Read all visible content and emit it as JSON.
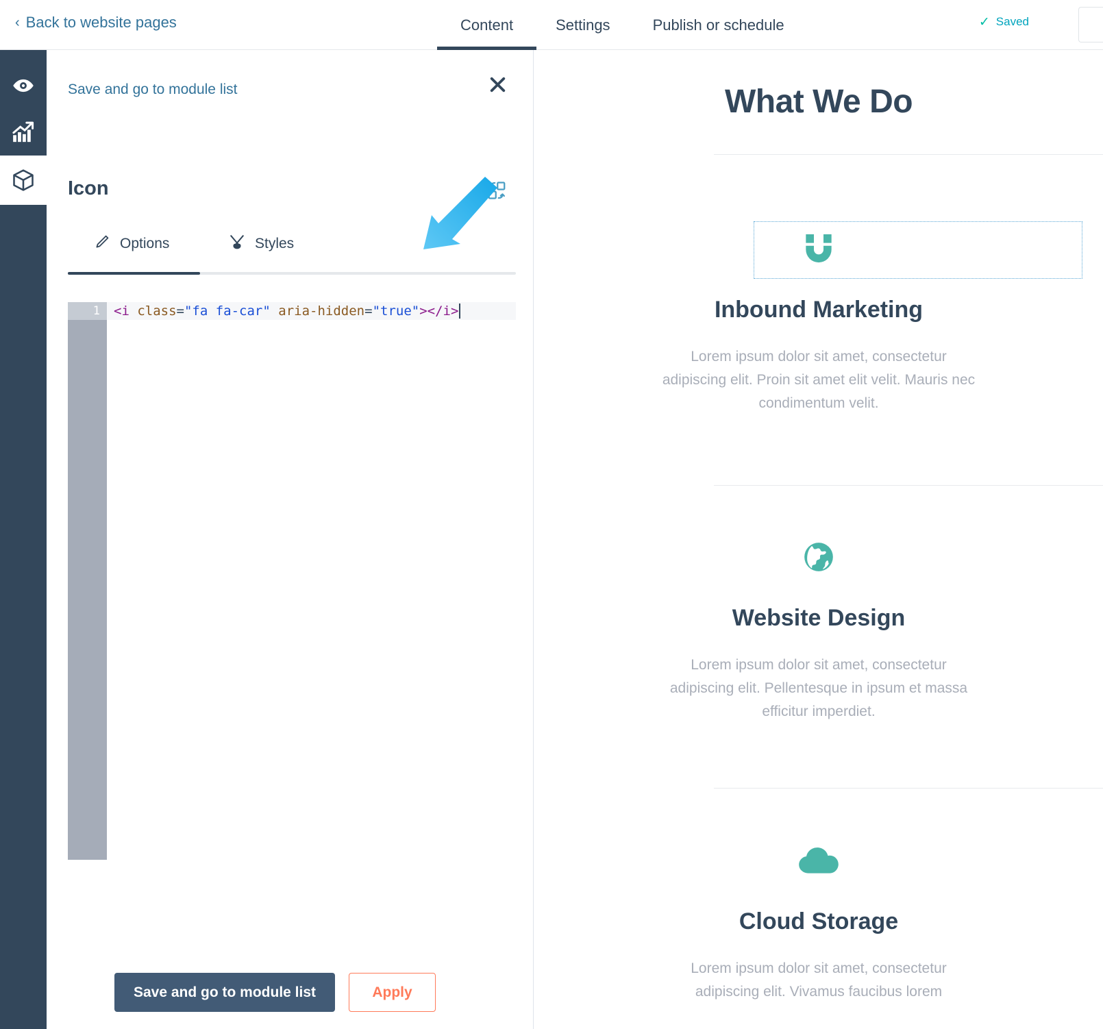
{
  "topbar": {
    "back_label": "Back to website pages",
    "back_chevron": "‹",
    "tabs": [
      {
        "label": "Content",
        "active": true
      },
      {
        "label": "Settings",
        "active": false
      },
      {
        "label": "Publish or schedule",
        "active": false
      }
    ],
    "saved_label": "Saved",
    "saved_icon": "check-icon"
  },
  "rail": {
    "items": [
      {
        "icon": "eye-icon",
        "name": "preview"
      },
      {
        "icon": "chart-growth-icon",
        "name": "optimize"
      },
      {
        "icon": "cube-module-icon",
        "name": "modules",
        "active": true
      }
    ]
  },
  "panel": {
    "save_link": "Save and go to module list",
    "close_icon": "close-icon",
    "title": "Icon",
    "swap_icon": "swap-module-icon",
    "tabs": [
      {
        "label": "Options",
        "icon": "pencil-icon",
        "active": true
      },
      {
        "label": "Styles",
        "icon": "paintbrush-icon",
        "active": false
      }
    ],
    "editor": {
      "line_number": "1",
      "code_tokens": [
        {
          "type": "tag",
          "text": "<i "
        },
        {
          "type": "attr",
          "text": "class"
        },
        {
          "type": "eq",
          "text": "="
        },
        {
          "type": "str",
          "text": "\"fa fa-car\""
        },
        {
          "type": "eq",
          "text": " "
        },
        {
          "type": "attr",
          "text": "aria-hidden"
        },
        {
          "type": "eq",
          "text": "="
        },
        {
          "type": "str",
          "text": "\"true\""
        },
        {
          "type": "tag",
          "text": "></i>"
        }
      ],
      "code_plain": "<i class=\"fa fa-car\" aria-hidden=\"true\"></i>"
    },
    "buttons": {
      "primary": "Save and go to module list",
      "secondary": "Apply"
    }
  },
  "annotation": {
    "type": "arrow",
    "color": "#3fb6f0"
  },
  "preview": {
    "page_title": "What We Do",
    "cards": [
      {
        "icon": "magnet-icon",
        "icon_color": "#4ab5a8",
        "selected": true,
        "heading": "Inbound Marketing",
        "body": "Lorem ipsum dolor sit amet, consectetur adipiscing elit. Proin sit amet elit velit. Mauris nec condimentum velit."
      },
      {
        "icon": "globe-icon",
        "icon_color": "#4ab5a8",
        "selected": false,
        "heading": "Website Design",
        "body": "Lorem ipsum dolor sit amet, consectetur adipiscing elit. Pellentesque in ipsum et massa efficitur imperdiet."
      },
      {
        "icon": "cloud-icon",
        "icon_color": "#4ab5a8",
        "selected": false,
        "heading": "Cloud Storage",
        "body": "Lorem ipsum dolor sit amet, consectetur adipiscing elit. Vivamus faucibus lorem"
      }
    ]
  },
  "colors": {
    "brand_dark": "#33475b",
    "link_blue": "#33739a",
    "teal": "#4ab5a8",
    "orange": "#ff7a59",
    "arrow_blue": "#3fb6f0"
  }
}
